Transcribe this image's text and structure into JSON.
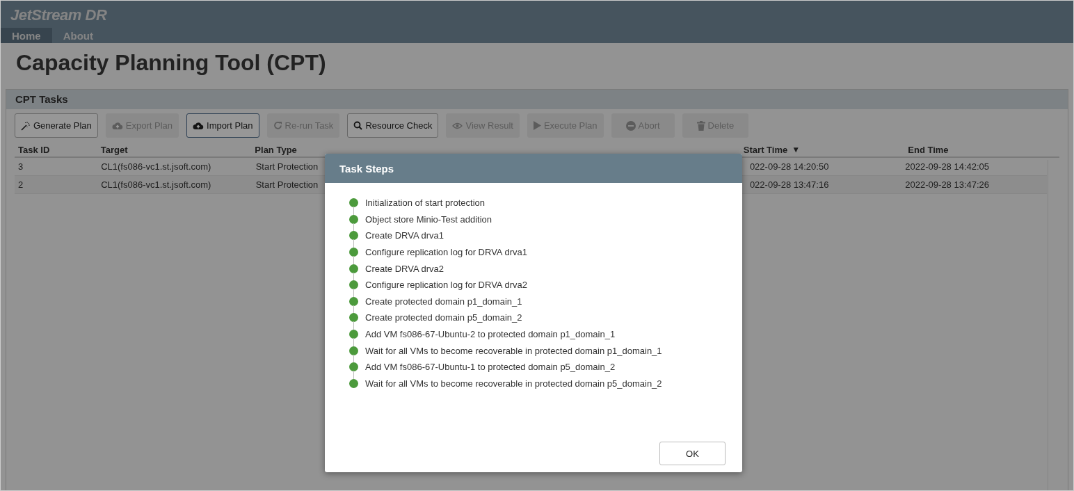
{
  "app": {
    "title": "JetStream DR"
  },
  "nav": [
    {
      "label": "Home",
      "selected": true
    },
    {
      "label": "About",
      "selected": false
    }
  ],
  "page_title": "Capacity Planning Tool (CPT)",
  "panel": {
    "title": "CPT Tasks",
    "toolbar": [
      {
        "label": "Generate Plan",
        "disabled": false,
        "focused": false
      },
      {
        "label": "Export Plan",
        "disabled": true,
        "focused": false
      },
      {
        "label": "Import Plan",
        "disabled": false,
        "focused": true
      },
      {
        "label": "Re-run Task",
        "disabled": true,
        "focused": false
      },
      {
        "label": "Resource Check",
        "disabled": false,
        "focused": false
      },
      {
        "label": "View Result",
        "disabled": true,
        "focused": false
      },
      {
        "label": "Execute Plan",
        "disabled": true,
        "focused": false
      },
      {
        "label": "Abort",
        "disabled": true,
        "focused": false
      },
      {
        "label": "Delete",
        "disabled": true,
        "focused": false
      }
    ],
    "table": {
      "columns": [
        {
          "label": "Task ID"
        },
        {
          "label": "Target"
        },
        {
          "label": "Plan Type"
        },
        {
          "label": "Start Time",
          "sort": "▼"
        },
        {
          "label": "End Time"
        }
      ],
      "rows": [
        {
          "task_id": "3",
          "target": "CL1(fs086-vc1.st.jsoft.com)",
          "plan_type": "Start Protection",
          "start_time": "022-09-28 14:20:50",
          "end_time": "2022-09-28 14:42:05"
        },
        {
          "task_id": "2",
          "target": "CL1(fs086-vc1.st.jsoft.com)",
          "plan_type": "Start Protection",
          "start_time": "022-09-28 13:47:16",
          "end_time": "2022-09-28 13:47:26"
        }
      ]
    }
  },
  "dialog": {
    "title": "Task Steps",
    "steps": [
      "Initialization of start protection",
      "Object store Minio-Test addition",
      "Create DRVA drva1",
      "Configure replication log for DRVA drva1",
      "Create DRVA drva2",
      "Configure replication log for DRVA drva2",
      "Create protected domain p1_domain_1",
      "Create protected domain p5_domain_2",
      "Add VM fs086-67-Ubuntu-2 to protected domain p1_domain_1",
      "Wait for all VMs to become recoverable in protected domain p1_domain_1",
      "Add VM fs086-67-Ubuntu-1 to protected domain p5_domain_2",
      "Wait for all VMs to become recoverable in protected domain p5_domain_2"
    ],
    "button": "OK"
  }
}
